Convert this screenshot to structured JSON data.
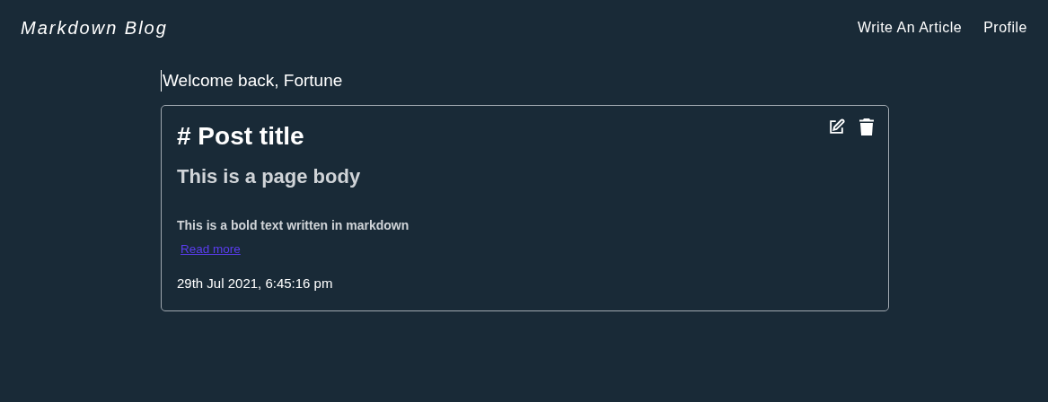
{
  "header": {
    "brand": "Markdown Blog",
    "nav": [
      "Write An Article",
      "Profile"
    ]
  },
  "welcome": "Welcome back, Fortune",
  "posts": [
    {
      "title": "# Post title",
      "subtitle": "This is a page body",
      "excerpt": "This is a bold text written in markdown",
      "link": "Read more",
      "date": "29th Jul 2021, 6:45:16 pm"
    }
  ]
}
